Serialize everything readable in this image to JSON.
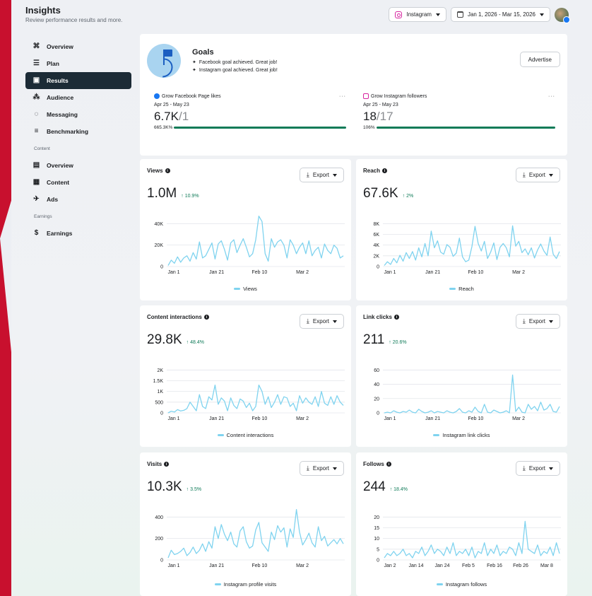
{
  "header": {
    "title": "Insights",
    "subtitle": "Review performance results and more."
  },
  "controls": {
    "platform": "Instagram",
    "date_range": "Jan 1, 2026 - Mar 15, 2026"
  },
  "sidebar": {
    "items": [
      {
        "label": "Overview",
        "icon": "overview-icon",
        "glyph": "⌘"
      },
      {
        "label": "Plan",
        "icon": "list-icon",
        "glyph": "☰"
      },
      {
        "label": "Results",
        "icon": "chart-icon",
        "glyph": "▣",
        "active": true
      },
      {
        "label": "Audience",
        "icon": "people-icon",
        "glyph": "⁂"
      },
      {
        "label": "Messaging",
        "icon": "chat-icon",
        "glyph": "◌"
      },
      {
        "label": "Benchmarking",
        "icon": "benchmark-icon",
        "glyph": "≡"
      }
    ],
    "content_section": "Content",
    "content_items": [
      {
        "label": "Overview",
        "icon": "content-overview-icon",
        "glyph": "▤"
      },
      {
        "label": "Content",
        "icon": "grid-icon",
        "glyph": "▦"
      },
      {
        "label": "Ads",
        "icon": "megaphone-icon",
        "glyph": "✈"
      }
    ],
    "earnings_section": "Earnings",
    "earnings_items": [
      {
        "label": "Earnings",
        "icon": "dollar-icon",
        "glyph": "$"
      }
    ]
  },
  "goals": {
    "title": "Goals",
    "line1": "Facebook goal achieved. Great job!",
    "line2": "Instagram goal achieved. Great job!",
    "advertise": "Advertise",
    "facebook": {
      "label": "Grow Facebook Page likes",
      "range": "Apr 25 - May 23",
      "value": "6.7K",
      "target": "/1",
      "percent": "665.3K%",
      "more": "···"
    },
    "instagram": {
      "label": "Grow Instagram followers",
      "range": "Apr 25 - May 23",
      "value": "18",
      "target": "/17",
      "percent": "106%",
      "more": "···"
    }
  },
  "export_label": "Export",
  "metrics": [
    {
      "key": "views",
      "title": "Views",
      "value": "1.0M",
      "change": "↑ 10.9%",
      "legend": "Views"
    },
    {
      "key": "reach",
      "title": "Reach",
      "value": "67.6K",
      "change": "↑ 2%",
      "legend": "Reach"
    },
    {
      "key": "interactions",
      "title": "Content interactions",
      "value": "29.8K",
      "change": "↑ 48.4%",
      "legend": "Content interactions"
    },
    {
      "key": "links",
      "title": "Link clicks",
      "value": "211",
      "change": "↑ 20.6%",
      "legend": "Instagram link clicks"
    },
    {
      "key": "visits",
      "title": "Visits",
      "value": "10.3K",
      "change": "↑ 3.5%",
      "legend": "Instagram profile visits"
    },
    {
      "key": "follows",
      "title": "Follows",
      "value": "244",
      "change": "↑ 18.4%",
      "legend": "Instagram follows"
    }
  ],
  "chart_data": [
    {
      "type": "line",
      "title": "Views",
      "yticks": [
        "0",
        "20K",
        "40K"
      ],
      "ylim": [
        0,
        48000
      ],
      "xticks": [
        "Jan 1",
        "Jan 21",
        "Feb 10",
        "Mar 2"
      ],
      "values": [
        1000,
        6000,
        3000,
        9000,
        4000,
        8000,
        10000,
        5000,
        13000,
        7000,
        23000,
        8000,
        10000,
        16000,
        22000,
        7000,
        21000,
        24000,
        16000,
        6000,
        22000,
        25000,
        13000,
        20000,
        26000,
        18000,
        9000,
        12000,
        25000,
        47000,
        42000,
        12000,
        5000,
        26000,
        18000,
        23000,
        25000,
        20000,
        8000,
        25000,
        20000,
        12000,
        18000,
        22000,
        12000,
        24000,
        10000,
        15000,
        18000,
        8000,
        21000,
        15000,
        12000,
        20000,
        17000,
        8000,
        10000
      ]
    },
    {
      "type": "line",
      "title": "Reach",
      "yticks": [
        "0",
        "2K",
        "4K",
        "6K",
        "8K"
      ],
      "ylim": [
        0,
        8000
      ],
      "xticks": [
        "Jan 1",
        "Jan 21",
        "Feb 10",
        "Mar 2"
      ],
      "values": [
        200,
        900,
        400,
        1500,
        700,
        2100,
        1000,
        2600,
        1500,
        2800,
        1200,
        3500,
        1800,
        4300,
        2000,
        6600,
        3500,
        4800,
        2700,
        2300,
        4100,
        3600,
        1900,
        2500,
        5300,
        1800,
        900,
        1200,
        3700,
        7500,
        4300,
        2900,
        4700,
        1500,
        2700,
        4400,
        1300,
        3600,
        4300,
        3500,
        1800,
        7600,
        3800,
        4700,
        2600,
        3300,
        2200,
        3500,
        1600,
        3100,
        4200,
        2900,
        2100,
        5500,
        2300,
        1500,
        2800
      ]
    },
    {
      "type": "line",
      "title": "Content interactions",
      "yticks": [
        "0",
        "500",
        "1K",
        "1.5K",
        "2K"
      ],
      "ylim": [
        0,
        2000
      ],
      "xticks": [
        "Jan 1",
        "Jan 21",
        "Feb 10",
        "Mar 2"
      ],
      "values": [
        0,
        80,
        40,
        150,
        90,
        120,
        200,
        500,
        300,
        100,
        850,
        300,
        200,
        750,
        600,
        1300,
        400,
        700,
        550,
        100,
        700,
        350,
        200,
        650,
        550,
        250,
        450,
        100,
        300,
        1300,
        1000,
        400,
        750,
        250,
        500,
        850,
        400,
        750,
        700,
        300,
        450,
        100,
        800,
        450,
        700,
        500,
        400,
        750,
        300,
        1000,
        450,
        350,
        750,
        400,
        800,
        500,
        350
      ]
    },
    {
      "type": "line",
      "title": "Link clicks",
      "yticks": [
        "0",
        "20",
        "40",
        "60"
      ],
      "ylim": [
        0,
        60
      ],
      "xticks": [
        "Jan 1",
        "Jan 21",
        "Feb 10",
        "Mar 2"
      ],
      "values": [
        0,
        1,
        0,
        3,
        1,
        0,
        2,
        1,
        4,
        1,
        0,
        5,
        2,
        0,
        1,
        3,
        0,
        2,
        1,
        0,
        3,
        1,
        0,
        2,
        6,
        1,
        0,
        3,
        1,
        8,
        2,
        0,
        12,
        1,
        0,
        4,
        2,
        0,
        1,
        3,
        0,
        53,
        2,
        8,
        1,
        0,
        12,
        5,
        9,
        3,
        15,
        4,
        6,
        12,
        2,
        1,
        9
      ]
    },
    {
      "type": "line",
      "title": "Visits",
      "yticks": [
        "0",
        "200",
        "400"
      ],
      "ylim": [
        0,
        480
      ],
      "xticks": [
        "Jan 1",
        "Jan 21",
        "Feb 10",
        "Mar 2"
      ],
      "values": [
        20,
        90,
        50,
        60,
        80,
        110,
        40,
        70,
        120,
        60,
        90,
        150,
        80,
        170,
        110,
        310,
        200,
        330,
        240,
        180,
        260,
        150,
        120,
        270,
        310,
        170,
        110,
        130,
        280,
        350,
        160,
        120,
        80,
        260,
        190,
        320,
        260,
        300,
        120,
        290,
        210,
        470,
        260,
        140,
        190,
        250,
        160,
        120,
        310,
        180,
        220,
        130,
        160,
        190,
        150,
        200,
        150
      ]
    },
    {
      "type": "line",
      "title": "Follows",
      "yticks": [
        "0",
        "5",
        "10",
        "15",
        "20"
      ],
      "ylim": [
        0,
        20
      ],
      "xticks": [
        "Jan 2",
        "Jan 14",
        "Jan 24",
        "Feb 5",
        "Feb 16",
        "Feb 26",
        "Mar 8"
      ],
      "values": [
        1,
        3,
        2,
        4,
        2,
        3,
        5,
        2,
        3,
        1,
        4,
        3,
        6,
        2,
        4,
        7,
        3,
        5,
        4,
        2,
        6,
        3,
        8,
        2,
        4,
        3,
        5,
        2,
        6,
        1,
        4,
        3,
        8,
        2,
        5,
        3,
        7,
        2,
        4,
        3,
        6,
        5,
        2,
        8,
        3,
        18,
        5,
        4,
        3,
        7,
        2,
        4,
        3,
        6,
        2,
        8,
        3
      ]
    }
  ]
}
